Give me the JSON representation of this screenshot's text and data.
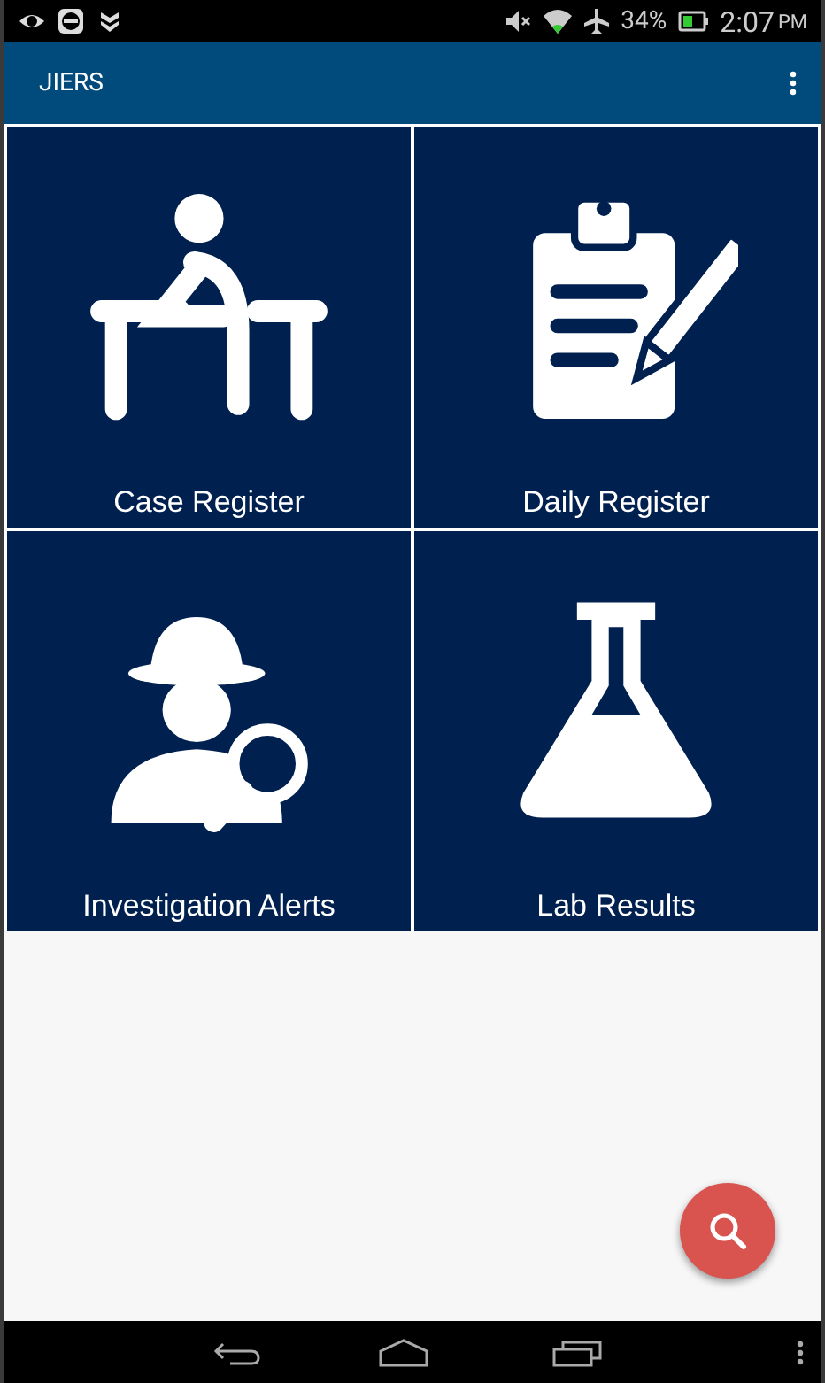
{
  "status_bar": {
    "battery": "34%",
    "time": "2:07",
    "time_suffix": "PM"
  },
  "app_bar": {
    "title": "JIERS"
  },
  "tiles": [
    {
      "label": "Case Register",
      "kind": "desk"
    },
    {
      "label": "Daily Register",
      "kind": "clipboard"
    },
    {
      "label": "Investigation Alerts",
      "kind": "detective"
    },
    {
      "label": "Lab Results",
      "kind": "flask"
    }
  ]
}
